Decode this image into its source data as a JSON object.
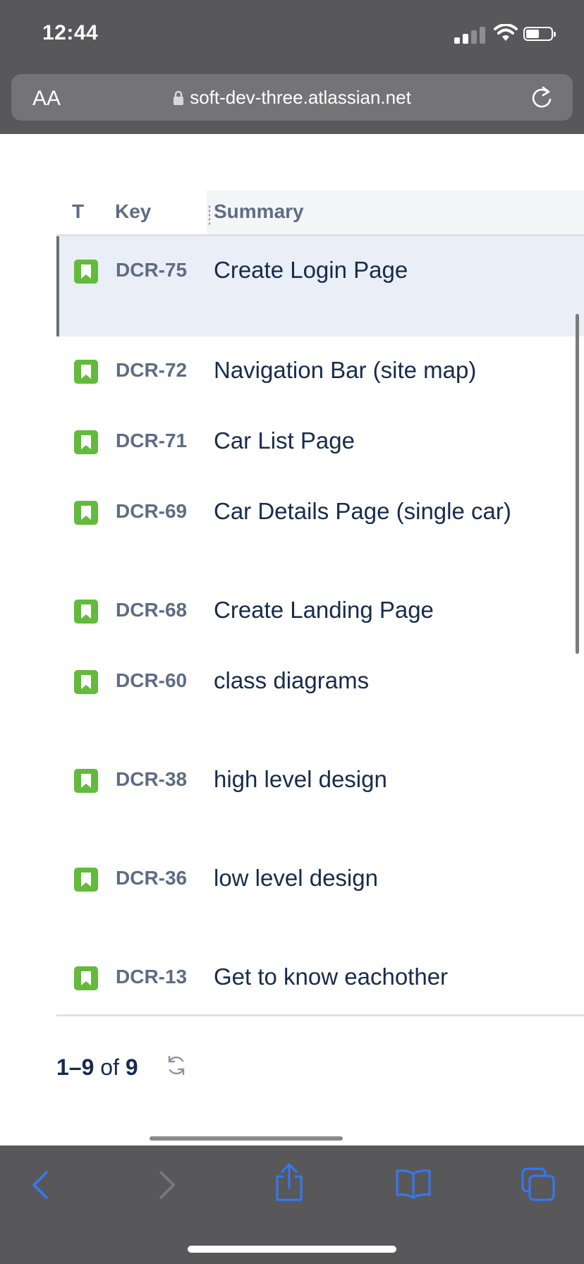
{
  "status_bar": {
    "time": "12:44",
    "icons": [
      "cellular-signal-icon",
      "wifi-icon",
      "battery-icon"
    ]
  },
  "browser": {
    "text_size_label": "AA",
    "url": "soft-dev-three.atlassian.net"
  },
  "table": {
    "columns": {
      "type": "T",
      "key": "Key",
      "summary": "Summary"
    },
    "rows": [
      {
        "key": "DCR-75",
        "summary": "Create Login Page",
        "type_icon": "story-icon",
        "selected": true
      },
      {
        "key": "DCR-72",
        "summary": "Navigation Bar (site map)",
        "type_icon": "story-icon"
      },
      {
        "key": "DCR-71",
        "summary": "Car List Page",
        "type_icon": "story-icon"
      },
      {
        "key": "DCR-69",
        "summary": "Car Details Page (single car)",
        "type_icon": "story-icon"
      },
      {
        "key": "DCR-68",
        "summary": "Create Landing Page",
        "type_icon": "story-icon"
      },
      {
        "key": "DCR-60",
        "summary": "class diagrams",
        "type_icon": "story-icon"
      },
      {
        "key": "DCR-38",
        "summary": "high level design",
        "type_icon": "story-icon"
      },
      {
        "key": "DCR-36",
        "summary": "low level design",
        "type_icon": "story-icon"
      },
      {
        "key": "DCR-13",
        "summary": "Get to know eachother",
        "type_icon": "story-icon"
      }
    ]
  },
  "pagination": {
    "range": "1–9",
    "of_label": "of",
    "total": "9"
  },
  "toolbar": {
    "buttons": [
      "back-icon",
      "forward-icon",
      "share-icon",
      "bookmarks-icon",
      "tabs-icon"
    ]
  },
  "colors": {
    "story_green": "#63ba3c",
    "link_blue": "#3478f6",
    "chrome_gray": "#58585a",
    "selected_row": "#e9eef7"
  }
}
